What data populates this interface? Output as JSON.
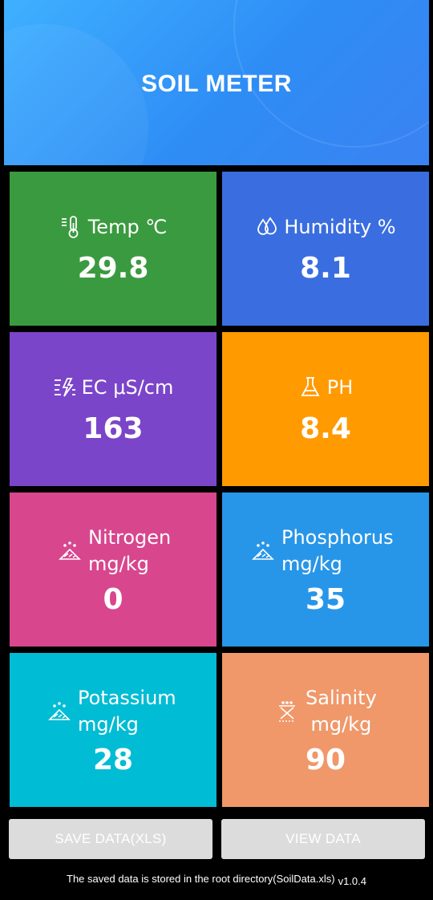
{
  "header": {
    "title": "SOIL METER"
  },
  "tiles": {
    "temp": {
      "label": "Temp ℃",
      "value": "29.8",
      "color": "#3a9a3f"
    },
    "humidity": {
      "label": "Humidity %",
      "value": "8.1",
      "color": "#3a6ee0"
    },
    "ec": {
      "label": "EC μS/cm",
      "value": "163",
      "color": "#7b45c9"
    },
    "ph": {
      "label": "PH",
      "value": "8.4",
      "color": "#ff9a00"
    },
    "nitrogen": {
      "label": "Nitrogen",
      "unit": "mg/kg",
      "value": "0",
      "color": "#d8468e"
    },
    "phosphorus": {
      "label": "Phosphorus",
      "unit": "mg/kg",
      "value": "35",
      "color": "#2896e8"
    },
    "potassium": {
      "label": "Potassium",
      "unit": "mg/kg",
      "value": "28",
      "color": "#00bcd4"
    },
    "salinity": {
      "label": "Salinity",
      "unit": "mg/kg",
      "value": "90",
      "color": "#f0986a"
    }
  },
  "buttons": {
    "save": "SAVE DATA(XLS)",
    "view": "VIEW DATA"
  },
  "footer": {
    "text": "The saved data is stored in the root directory(SoilData.xls)",
    "version": "v1.0.4"
  }
}
